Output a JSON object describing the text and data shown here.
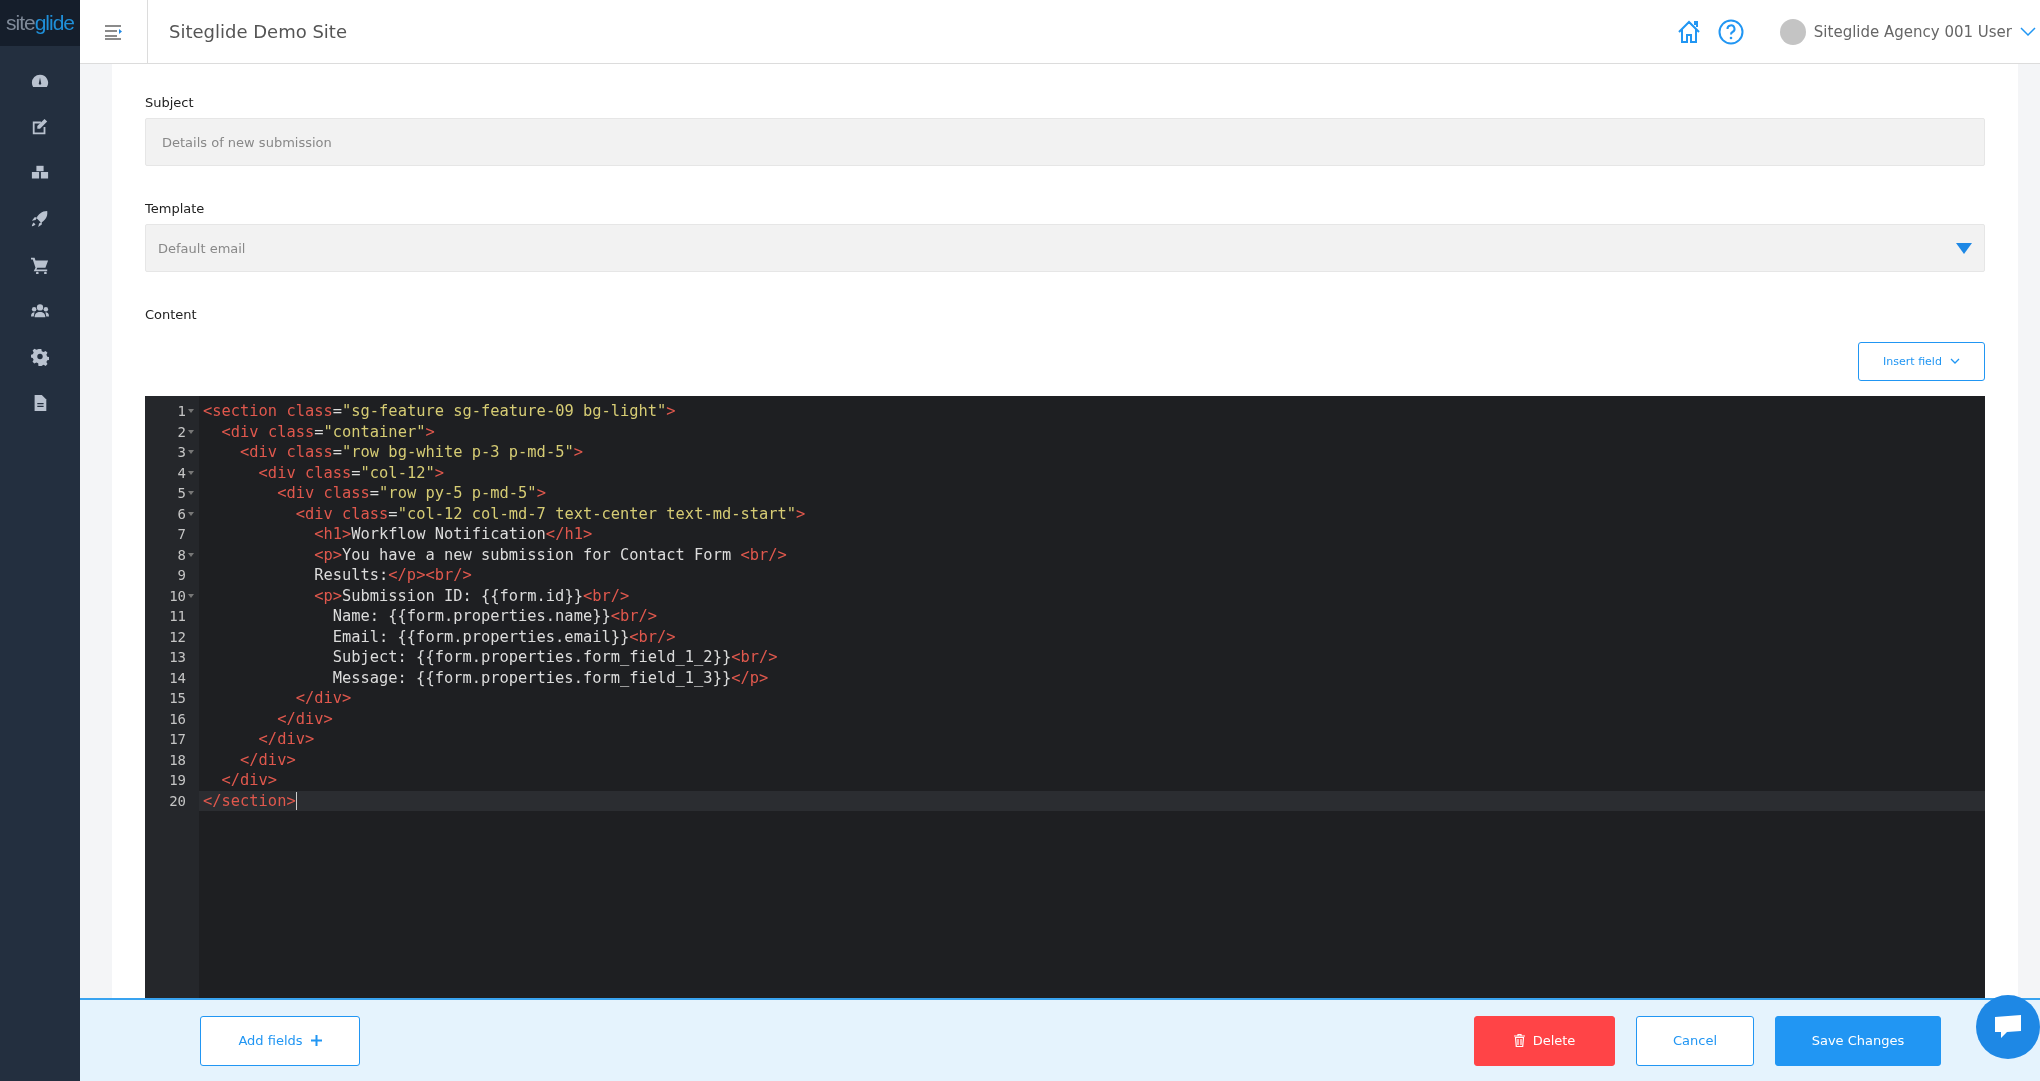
{
  "sidebar": {
    "logo": {
      "dim": "site",
      "accent": "glide"
    },
    "items": [
      {
        "kind": "dashboard"
      },
      {
        "kind": "edit"
      },
      {
        "kind": "modules"
      },
      {
        "kind": "launch"
      },
      {
        "kind": "cart"
      },
      {
        "kind": "users"
      },
      {
        "kind": "settings"
      },
      {
        "kind": "file"
      }
    ]
  },
  "header": {
    "title": "Siteglide Demo Site",
    "user": "Siteglide Agency 001 User"
  },
  "form": {
    "subject": {
      "label": "Subject",
      "value": "Details of new submission"
    },
    "template": {
      "label": "Template",
      "value": "Default email"
    },
    "content": {
      "label": "Content",
      "insert_button": "Insert field",
      "lines": [
        {
          "number": "1",
          "fold": true,
          "active": false,
          "tokens": [
            {
              "kind": "tag",
              "text": "<section"
            },
            {
              "kind": "attr",
              "text": " class"
            },
            {
              "kind": "text",
              "text": "="
            },
            {
              "kind": "string",
              "text": "\"sg-feature sg-feature-09 bg-light\""
            },
            {
              "kind": "tag",
              "text": ">"
            }
          ]
        },
        {
          "number": "2",
          "fold": true,
          "active": false,
          "tokens": [
            {
              "kind": "tag",
              "text": "  <div"
            },
            {
              "kind": "attr",
              "text": " class"
            },
            {
              "kind": "text",
              "text": "="
            },
            {
              "kind": "string",
              "text": "\"container\""
            },
            {
              "kind": "tag",
              "text": ">"
            }
          ]
        },
        {
          "number": "3",
          "fold": true,
          "active": false,
          "tokens": [
            {
              "kind": "tag",
              "text": "    <div"
            },
            {
              "kind": "attr",
              "text": " class"
            },
            {
              "kind": "text",
              "text": "="
            },
            {
              "kind": "string",
              "text": "\"row bg-white p-3 p-md-5\""
            },
            {
              "kind": "tag",
              "text": ">"
            }
          ]
        },
        {
          "number": "4",
          "fold": true,
          "active": false,
          "tokens": [
            {
              "kind": "tag",
              "text": "      <div"
            },
            {
              "kind": "attr",
              "text": " class"
            },
            {
              "kind": "text",
              "text": "="
            },
            {
              "kind": "string",
              "text": "\"col-12\""
            },
            {
              "kind": "tag",
              "text": ">"
            }
          ]
        },
        {
          "number": "5",
          "fold": true,
          "active": false,
          "tokens": [
            {
              "kind": "tag",
              "text": "        <div"
            },
            {
              "kind": "attr",
              "text": " class"
            },
            {
              "kind": "text",
              "text": "="
            },
            {
              "kind": "string",
              "text": "\"row py-5 p-md-5\""
            },
            {
              "kind": "tag",
              "text": ">"
            }
          ]
        },
        {
          "number": "6",
          "fold": true,
          "active": false,
          "tokens": [
            {
              "kind": "tag",
              "text": "          <div"
            },
            {
              "kind": "attr",
              "text": " class"
            },
            {
              "kind": "text",
              "text": "="
            },
            {
              "kind": "string",
              "text": "\"col-12 col-md-7 text-center text-md-start\""
            },
            {
              "kind": "tag",
              "text": ">"
            }
          ]
        },
        {
          "number": "7",
          "fold": false,
          "active": false,
          "tokens": [
            {
              "kind": "tag",
              "text": "            <h1>"
            },
            {
              "kind": "text",
              "text": "Workflow Notification"
            },
            {
              "kind": "tag",
              "text": "</h1>"
            }
          ]
        },
        {
          "number": "8",
          "fold": true,
          "active": false,
          "tokens": [
            {
              "kind": "tag",
              "text": "            <p>"
            },
            {
              "kind": "text",
              "text": "You have a new submission for Contact Form "
            },
            {
              "kind": "tag",
              "text": "<br/>"
            }
          ]
        },
        {
          "number": "9",
          "fold": false,
          "active": false,
          "tokens": [
            {
              "kind": "text",
              "text": "            Results:"
            },
            {
              "kind": "tag",
              "text": "</p><br/>"
            }
          ]
        },
        {
          "number": "10",
          "fold": true,
          "active": false,
          "tokens": [
            {
              "kind": "tag",
              "text": "            <p>"
            },
            {
              "kind": "text",
              "text": "Submission ID: {{form.id}}"
            },
            {
              "kind": "tag",
              "text": "<br/>"
            }
          ]
        },
        {
          "number": "11",
          "fold": false,
          "active": false,
          "tokens": [
            {
              "kind": "text",
              "text": "              Name: {{form.properties.name}}"
            },
            {
              "kind": "tag",
              "text": "<br/>"
            }
          ]
        },
        {
          "number": "12",
          "fold": false,
          "active": false,
          "tokens": [
            {
              "kind": "text",
              "text": "              Email: {{form.properties.email}}"
            },
            {
              "kind": "tag",
              "text": "<br/>"
            }
          ]
        },
        {
          "number": "13",
          "fold": false,
          "active": false,
          "tokens": [
            {
              "kind": "text",
              "text": "              Subject: {{form.properties.form_field_1_2}}"
            },
            {
              "kind": "tag",
              "text": "<br/>"
            }
          ]
        },
        {
          "number": "14",
          "fold": false,
          "active": false,
          "tokens": [
            {
              "kind": "text",
              "text": "              Message: {{form.properties.form_field_1_3}}"
            },
            {
              "kind": "tag",
              "text": "</p>"
            }
          ]
        },
        {
          "number": "15",
          "fold": false,
          "active": false,
          "tokens": [
            {
              "kind": "tag",
              "text": "          </div>"
            }
          ]
        },
        {
          "number": "16",
          "fold": false,
          "active": false,
          "tokens": [
            {
              "kind": "tag",
              "text": "        </div>"
            }
          ]
        },
        {
          "number": "17",
          "fold": false,
          "active": false,
          "tokens": [
            {
              "kind": "tag",
              "text": "      </div>"
            }
          ]
        },
        {
          "number": "18",
          "fold": false,
          "active": false,
          "tokens": [
            {
              "kind": "tag",
              "text": "    </div>"
            }
          ]
        },
        {
          "number": "19",
          "fold": false,
          "active": false,
          "tokens": [
            {
              "kind": "tag",
              "text": "  </div>"
            }
          ]
        },
        {
          "number": "20",
          "fold": false,
          "active": true,
          "tokens": [
            {
              "kind": "tag",
              "text": "</section>"
            }
          ]
        }
      ]
    }
  },
  "footer": {
    "add_button": "Add fields",
    "actions": [
      {
        "label": "Delete",
        "kind": "danger"
      },
      {
        "label": "Cancel",
        "kind": "outline"
      },
      {
        "label": "Save Changes",
        "kind": "primary"
      }
    ]
  }
}
